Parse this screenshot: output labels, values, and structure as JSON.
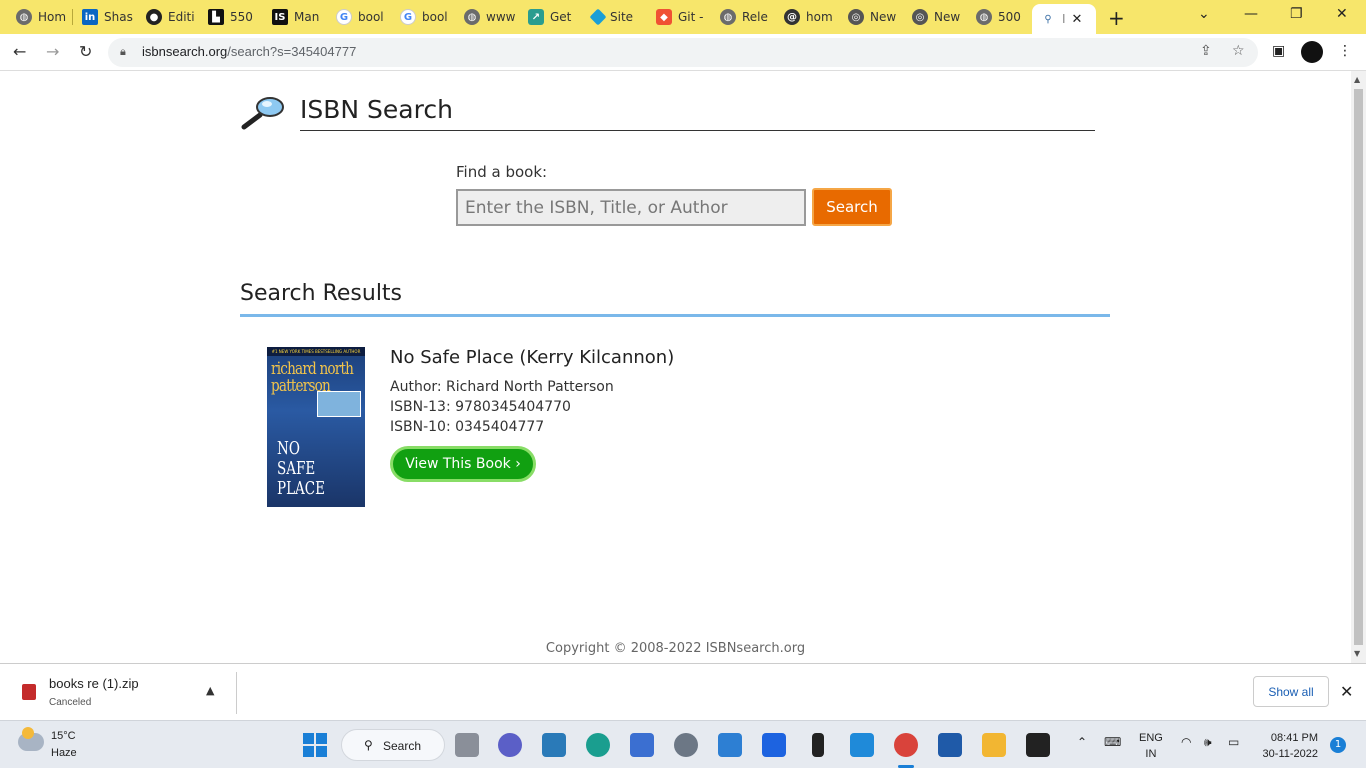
{
  "browser": {
    "tabs": [
      {
        "label": "Hom",
        "icon": "globe-icon",
        "color": "#6b6b6b"
      },
      {
        "label": "Shas",
        "icon": "linkedin-icon",
        "color": "#0a66c2"
      },
      {
        "label": "Editi",
        "icon": "github-icon",
        "color": "#222222"
      },
      {
        "label": "550",
        "icon": "bookmark-icon",
        "color": "#111111"
      },
      {
        "label": "Man",
        "icon": "is-logo-icon",
        "color": "#111111"
      },
      {
        "label": "bool",
        "icon": "google-icon",
        "color": "#4285f4"
      },
      {
        "label": "bool",
        "icon": "google-icon",
        "color": "#4285f4"
      },
      {
        "label": "www",
        "icon": "globe-icon",
        "color": "#6b6b6b"
      },
      {
        "label": "Get",
        "icon": "app-icon",
        "color": "#2a9d8f"
      },
      {
        "label": "Site",
        "icon": "diamond-icon",
        "color": "#1a9fd6"
      },
      {
        "label": "Git -",
        "icon": "git-icon",
        "color": "#f05133"
      },
      {
        "label": "Rele",
        "icon": "globe-icon",
        "color": "#6b6b6b"
      },
      {
        "label": "hom",
        "icon": "spiral-icon",
        "color": "#333333"
      },
      {
        "label": "New",
        "icon": "chrome-icon",
        "color": "#555555"
      },
      {
        "label": "New",
        "icon": "chrome-icon",
        "color": "#555555"
      },
      {
        "label": "500",
        "icon": "globe-icon",
        "color": "#6b6b6b"
      },
      {
        "label": "I",
        "icon": "magnifier-icon",
        "color": "#3a6ea5"
      }
    ],
    "url_host": "isbnsearch.org",
    "url_path": "/search?s=345404777"
  },
  "page": {
    "site_title": "ISBN Search",
    "find_label": "Find a book:",
    "search_placeholder": "Enter the ISBN, Title, or Author",
    "search_button": "Search",
    "results_heading": "Search Results",
    "result": {
      "title": "No Safe Place (Kerry Kilcannon)",
      "author": "Author: Richard North Patterson",
      "isbn13": "ISBN-13: 9780345404770",
      "isbn10": "ISBN-10: 0345404777",
      "view_button": "View This Book ›",
      "cover_banner": "#1 NEW YORK TIMES BESTSELLING AUTHOR",
      "cover_author": "richard north patterson",
      "cover_title": "NO SAFE PLACE"
    },
    "copyright": "Copyright © 2008-2022 ISBNsearch.org"
  },
  "download": {
    "filename": "books re (1).zip",
    "status": "Canceled",
    "show_all": "Show all"
  },
  "taskbar": {
    "temperature": "15°C",
    "condition": "Haze",
    "search_label": "Search",
    "lang_line1": "ENG",
    "lang_line2": "IN",
    "time": "08:41 PM",
    "date": "30-11-2022",
    "notification_count": "1"
  },
  "colors": {
    "tab_strip": "#f7e66b",
    "search_button": "#e86a00",
    "view_button": "#11a011",
    "results_rule": "#7ab8ea"
  }
}
